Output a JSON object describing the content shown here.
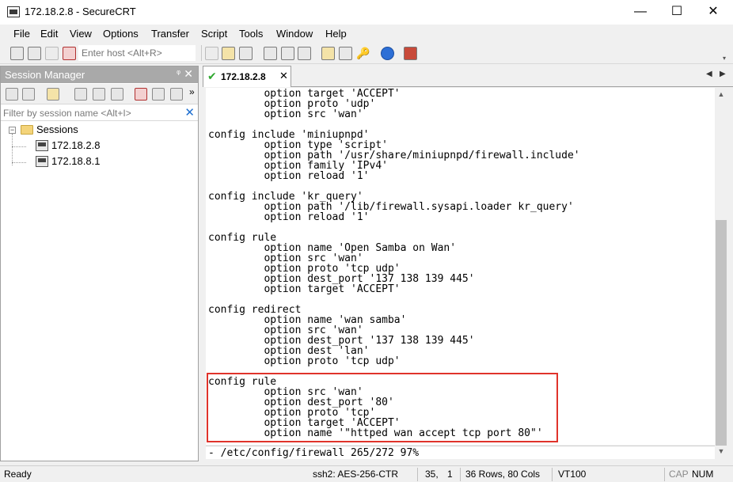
{
  "window": {
    "title": "172.18.2.8 - SecureCRT",
    "minimize_glyph": "—",
    "maximize_glyph": "☐",
    "close_glyph": "✕"
  },
  "menu": [
    "File",
    "Edit",
    "View",
    "Options",
    "Transfer",
    "Script",
    "Tools",
    "Window",
    "Help"
  ],
  "toolbar": {
    "host_placeholder": "Enter host <Alt+R>",
    "icons": [
      "connect-icon",
      "quick-connect-icon",
      "reconnect-icon",
      "disconnect-icon",
      "copy-icon",
      "paste-icon",
      "find-icon",
      "print-setup-icon",
      "print-icon",
      "print-screen-icon",
      "session-options-icon",
      "global-options-icon",
      "keymap-icon",
      "help-icon",
      "sftp-icon"
    ]
  },
  "session_manager": {
    "title": "Session Manager",
    "pin_glyph": "ᵠ",
    "close_glyph": "✕",
    "filter_placeholder": "Filter by session name <Alt+I>",
    "filter_clear_glyph": "✕",
    "root": {
      "label": "Sessions",
      "expander": "−"
    },
    "sessions": [
      "172.18.2.8",
      "172.18.8.1"
    ],
    "toolbar_more": "»"
  },
  "tab": {
    "label": "172.18.2.8",
    "status_glyph": "✔",
    "close_glyph": "✕",
    "prev_glyph": "◀",
    "next_glyph": "▶"
  },
  "terminal": {
    "lines": [
      "         option target 'ACCEPT'",
      "         option proto 'udp'",
      "         option src 'wan'",
      "",
      "config include 'miniupnpd'",
      "         option type 'script'",
      "         option path '/usr/share/miniupnpd/firewall.include'",
      "         option family 'IPv4'",
      "         option reload '1'",
      "",
      "config include 'kr_query'",
      "         option path '/lib/firewall.sysapi.loader kr_query'",
      "         option reload '1'",
      "",
      "config rule",
      "         option name 'Open Samba on Wan'",
      "         option src 'wan'",
      "         option proto 'tcp udp'",
      "         option dest_port '137 138 139 445'",
      "         option target 'ACCEPT'",
      "",
      "config redirect",
      "         option name 'wan samba'",
      "         option src 'wan'",
      "         option dest_port '137 138 139 445'",
      "         option dest 'lan'",
      "         option proto 'tcp udp'",
      "",
      "config rule",
      "         option src 'wan'",
      "         option dest_port '80'",
      "         option proto 'tcp'",
      "         option target 'ACCEPT'",
      "         option name '\"httped wan accept tcp port 80\"'"
    ],
    "status_line": "- /etc/config/firewall 265/272 97%",
    "highlight_color": "#e0332b"
  },
  "statusbar": {
    "ready": "Ready",
    "cipher": "ssh2: AES-256-CTR",
    "row": "35,",
    "col": "1",
    "dims": "36 Rows, 80 Cols",
    "emulation": "VT100",
    "cap": "CAP",
    "num": "NUM"
  }
}
